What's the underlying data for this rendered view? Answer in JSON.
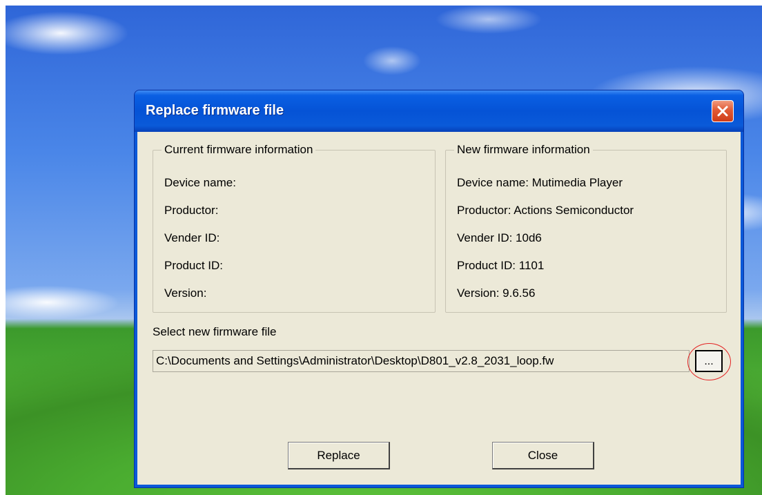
{
  "window": {
    "title": "Replace firmware file"
  },
  "current_firmware": {
    "legend": "Current firmware information",
    "device_name": "Device name:",
    "productor": "Productor:",
    "vender_id": "Vender ID:",
    "product_id": "Product ID:",
    "version": "Version:"
  },
  "new_firmware": {
    "legend": "New firmware information",
    "device_name": "Device name: Mutimedia Player",
    "productor": "Productor: Actions Semiconductor",
    "vender_id": "Vender ID: 10d6",
    "product_id": "Product ID: 1101",
    "version": "Version:  9.6.56"
  },
  "file_select": {
    "label": "Select new firmware file",
    "path": "C:\\Documents and Settings\\Administrator\\Desktop\\D801_v2.8_2031_loop.fw",
    "browse_label": "..."
  },
  "buttons": {
    "replace": "Replace",
    "close": "Close"
  },
  "icons": {
    "close": "close-x-icon"
  },
  "colors": {
    "titlebar": "#0553d6",
    "dialog_bg": "#ece9d8",
    "close_button": "#e05a35",
    "highlight_circle": "#e32222"
  }
}
